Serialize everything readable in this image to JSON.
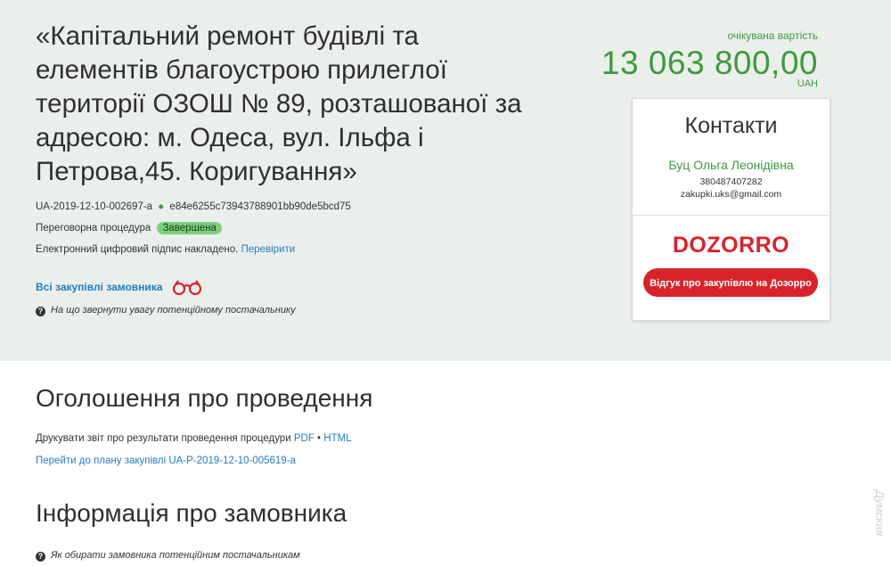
{
  "tender": {
    "title": "«Капітальний ремонт будівлі та елементів благоустрою прилеглої території ОЗОШ № 89, розташованої за адресою: м. Одеса, вул. Ільфа і Петрова,45. Коригування»",
    "id": "UA-2019-12-10-002697-a",
    "hash": "e84e6255c73943788901bb90de5bcd75",
    "procedure_type": "Переговорна процедура",
    "status": "Завершена",
    "signature_text": "Електронний цифровий підпис накладено.",
    "signature_link": "Перевірити",
    "all_purchases_link": "Всі закупівлі замовника",
    "hint": "На що звернути увагу потенційному постачальнику"
  },
  "expected_value": {
    "label": "очікувана вартість",
    "amount": "13 063 800,00",
    "currency": "UAH"
  },
  "contacts": {
    "title": "Контакти",
    "name": "Буц Ольга Леонідівна",
    "phone": "380487407282",
    "email": "zakupki.uks@gmail.com"
  },
  "dozorro": {
    "logo": "DOZORRO",
    "button": "Відгук про закупівлю на Дозорро"
  },
  "announcement": {
    "title": "Оголошення про проведення",
    "print_text": "Друкувати звіт про результати проведення процедури",
    "pdf": "PDF",
    "separator": "•",
    "html": "HTML",
    "plan_link": "Перейти до плану закупівлі UA-P-2019-12-10-005619-a"
  },
  "customer": {
    "title": "Інформація про замовника",
    "hint": "Як обирати замовника потенційним постачальникам"
  },
  "watermark": "Думская",
  "icons": {
    "binoculars": "binoculars-icon",
    "question": "question-icon",
    "dot": "green-dot-icon"
  },
  "colors": {
    "accent_green": "#3d9a3d",
    "link_blue": "#1f7dc0",
    "dozorro_red": "#d8232a",
    "hero_bg": "#ebefeb"
  }
}
